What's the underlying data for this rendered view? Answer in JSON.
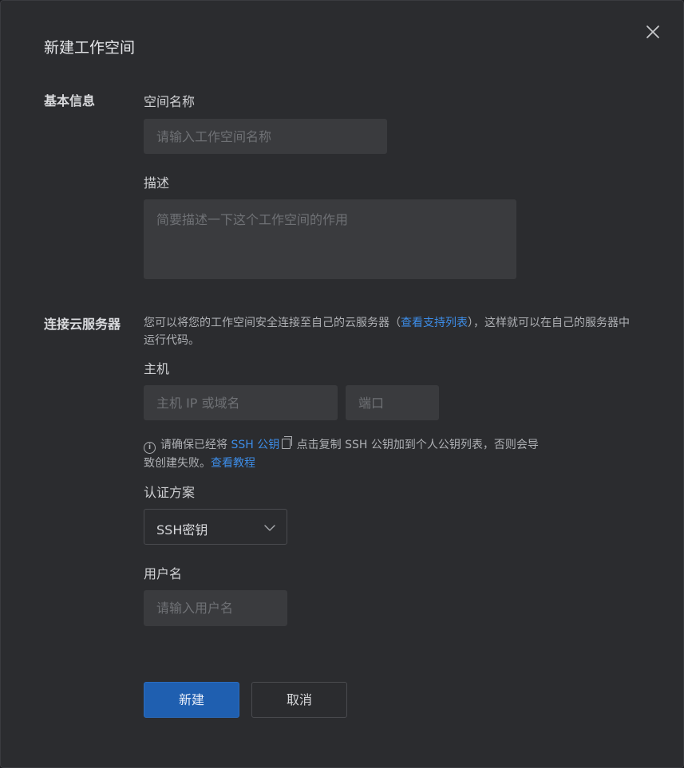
{
  "dialog": {
    "title": "新建工作空间",
    "close_icon": "close-icon"
  },
  "basic_info": {
    "section_label": "基本信息",
    "name_label": "空间名称",
    "name_placeholder": "请输入工作空间名称",
    "desc_label": "描述",
    "desc_placeholder": "简要描述一下这个工作空间的作用"
  },
  "server": {
    "section_label": "连接云服务器",
    "intro_before": "您可以将您的工作空间安全连接至自己的云服务器（",
    "intro_link": "查看支持列表",
    "intro_after": "），这样就可以在自己的服务器中运行代码。",
    "host_label": "主机",
    "host_placeholder": "主机 IP 或域名",
    "port_placeholder": "端口",
    "notice_before": "请确保已经将 ",
    "notice_ssh_link": "SSH 公钥",
    "notice_middle": " 点击复制 SSH 公钥加到个人公钥列表，否则会导致创建失败。",
    "notice_tutorial_link": "查看教程",
    "auth_label": "认证方案",
    "auth_value": "SSH密钥",
    "user_label": "用户名",
    "user_placeholder": "请输入用户名"
  },
  "actions": {
    "create_label": "新建",
    "cancel_label": "取消"
  },
  "colors": {
    "accent": "#1f5fb0",
    "link": "#3d8de8",
    "background": "#2b2c2f"
  }
}
